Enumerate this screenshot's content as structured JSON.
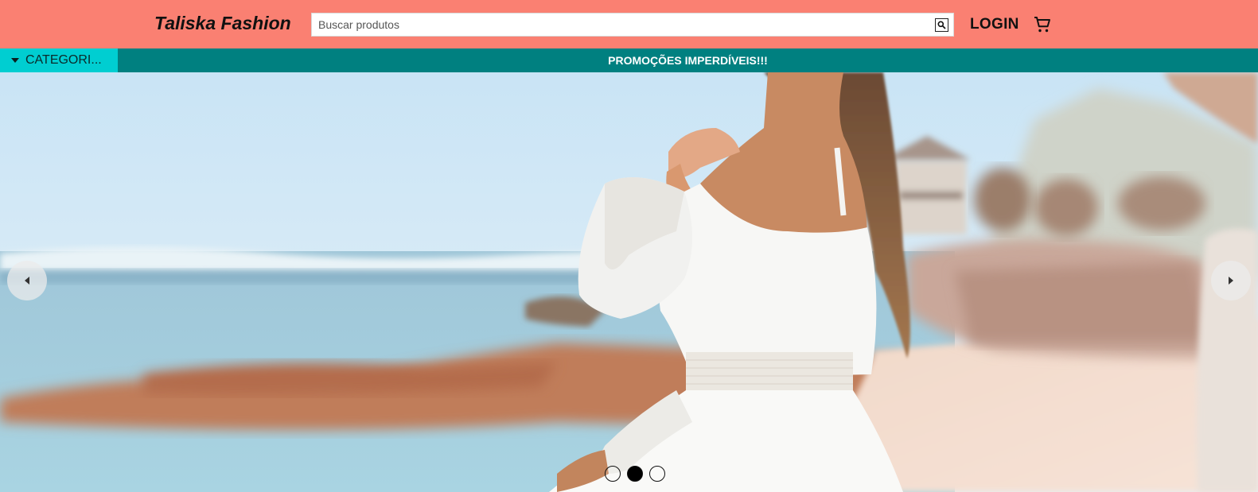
{
  "header": {
    "brand": "Taliska Fashion",
    "search_placeholder": "Buscar produtos",
    "search_value": "",
    "login_label": "LOGIN",
    "search_icon": "search-icon",
    "cart_icon": "shopping-cart-icon"
  },
  "navbar": {
    "categories_label": "CATEGORI...",
    "promo_text": "PROMOÇÕES IMPERDÍVEIS!!!"
  },
  "carousel": {
    "total_slides": 3,
    "active_slide": 2,
    "prev_icon": "chevron-left-icon",
    "next_icon": "chevron-right-icon"
  },
  "colors": {
    "header_bg": "#fa8072",
    "navbar_bg": "#008080",
    "categories_bg": "#00ced1"
  }
}
